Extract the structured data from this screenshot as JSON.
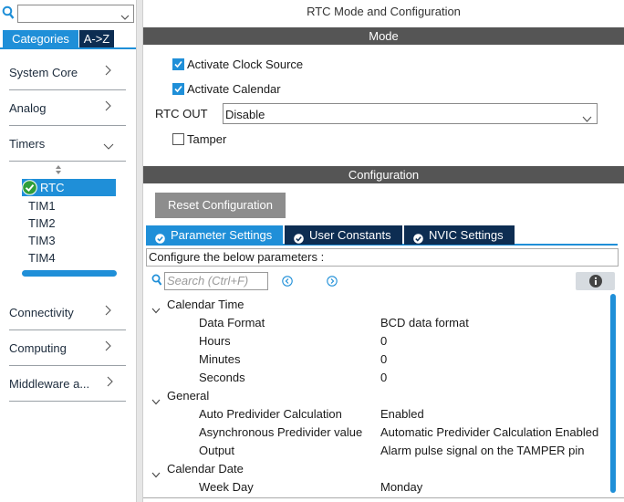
{
  "colors": {
    "accent": "#1f8fd8",
    "dark_tab": "#0d2d52",
    "bar": "#555555",
    "button": "#8d8d8d",
    "check_green": "#2e9e3a"
  },
  "left": {
    "search": {
      "icon": "search-icon",
      "value": ""
    },
    "tabs": {
      "categories": "Categories",
      "az": "A->Z"
    },
    "nav": [
      {
        "label": "System Core",
        "state": "collapsed"
      },
      {
        "label": "Analog",
        "state": "collapsed"
      },
      {
        "label": "Timers",
        "state": "expanded"
      }
    ],
    "timers": [
      {
        "label": "RTC",
        "selected": true,
        "ok": true
      },
      {
        "label": "TIM1"
      },
      {
        "label": "TIM2"
      },
      {
        "label": "TIM3"
      },
      {
        "label": "TIM4"
      }
    ],
    "nav2": [
      {
        "label": "Connectivity",
        "state": "collapsed"
      },
      {
        "label": "Computing",
        "state": "collapsed"
      },
      {
        "label": "Middleware a...",
        "state": "collapsed"
      }
    ]
  },
  "right": {
    "title": "RTC Mode and Configuration",
    "mode_bar": "Mode",
    "mode": {
      "activate_clock_source": {
        "label": "Activate Clock Source",
        "checked": true
      },
      "activate_calendar": {
        "label": "Activate Calendar",
        "checked": true
      },
      "rtc_out": {
        "label": "RTC OUT",
        "value": "Disable"
      },
      "tamper": {
        "label": "Tamper",
        "checked": false
      }
    },
    "config_bar": "Configuration",
    "reset_button": "Reset Configuration",
    "tabs": [
      {
        "label": "Parameter Settings",
        "active": true
      },
      {
        "label": "User Constants",
        "active": false
      },
      {
        "label": "NVIC Settings",
        "active": false
      }
    ],
    "hint": "Configure the below parameters :",
    "search_placeholder": "Search (Ctrl+F)",
    "groups": [
      {
        "label": "Calendar Time",
        "params": [
          {
            "name": "Data Format",
            "value": "BCD data format"
          },
          {
            "name": "Hours",
            "value": "0"
          },
          {
            "name": "Minutes",
            "value": "0"
          },
          {
            "name": "Seconds",
            "value": "0"
          }
        ]
      },
      {
        "label": "General",
        "params": [
          {
            "name": "Auto Predivider Calculation",
            "value": "Enabled"
          },
          {
            "name": "Asynchronous Predivider value",
            "value": "Automatic Predivider Calculation Enabled"
          },
          {
            "name": "Output",
            "value": "Alarm pulse signal on the TAMPER pin"
          }
        ]
      },
      {
        "label": "Calendar Date",
        "params": [
          {
            "name": "Week Day",
            "value": "Monday"
          }
        ]
      }
    ]
  }
}
